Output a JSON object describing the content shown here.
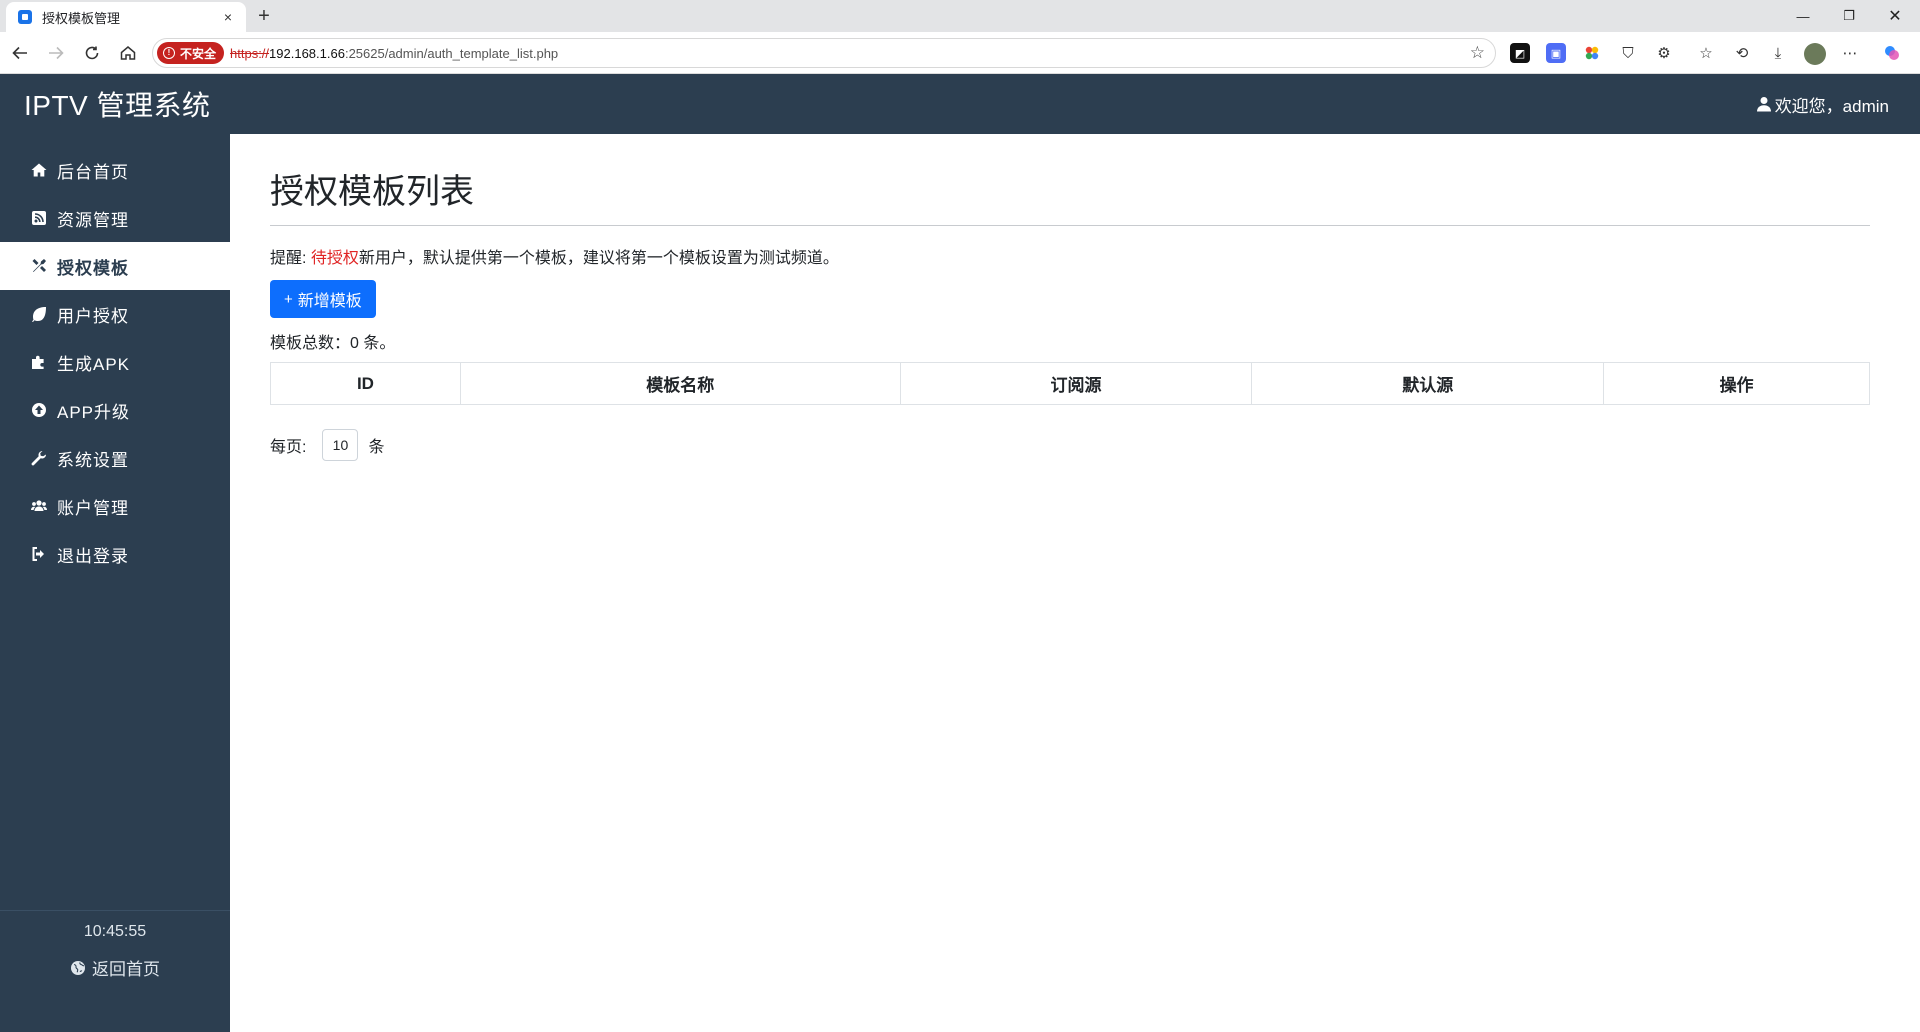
{
  "browser": {
    "tab_title": "授权模板管理",
    "tab_close": "×",
    "new_tab": "+",
    "security_label": "不安全",
    "url_scheme": "https://",
    "url_host": "192.168.1.66",
    "url_rest": ":25625/admin/auth_template_list.php",
    "window_min": "—",
    "window_max": "❐",
    "window_close": "✕"
  },
  "app": {
    "brand": "IPTV 管理系统",
    "welcome": "欢迎您，admin",
    "accent_color": "#0d6efd",
    "sidebar_color": "#2c3e50"
  },
  "sidebar": {
    "items": [
      {
        "label": "后台首页",
        "icon": "home-icon",
        "active": false
      },
      {
        "label": "资源管理",
        "icon": "rss-icon",
        "active": false
      },
      {
        "label": "授权模板",
        "icon": "tools-icon",
        "active": true
      },
      {
        "label": "用户授权",
        "icon": "leaf-icon",
        "active": false
      },
      {
        "label": "生成APK",
        "icon": "puzzle-icon",
        "active": false
      },
      {
        "label": "APP升级",
        "icon": "upload-circle-icon",
        "active": false
      },
      {
        "label": "系统设置",
        "icon": "wrench-icon",
        "active": false
      },
      {
        "label": "账户管理",
        "icon": "users-icon",
        "active": false
      },
      {
        "label": "退出登录",
        "icon": "logout-icon",
        "active": false
      }
    ],
    "clock": "10:45:55",
    "home_link": "返回首页"
  },
  "main": {
    "title": "授权模板列表",
    "tip_prefix": "提醒: ",
    "tip_highlight": "待授权",
    "tip_suffix": "新用户，默认提供第一个模板，建议将第一个模板设置为测试频道。",
    "add_button": "新增模板",
    "add_button_plus": "+",
    "count_text": "模板总数：0 条。",
    "table_headers": [
      "ID",
      "模板名称",
      "订阅源",
      "默认源",
      "操作"
    ],
    "per_page_label": "每页:",
    "per_page_value": "10",
    "per_page_unit": "条"
  }
}
